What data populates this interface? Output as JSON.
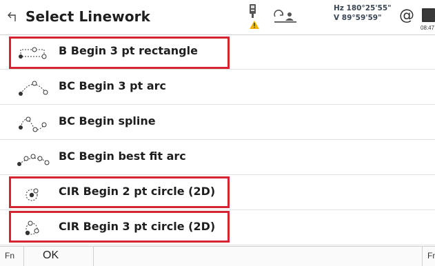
{
  "header": {
    "back_icon": "back-arrow-icon",
    "title": "Select Linework",
    "instrument_icon": "instrument-warning-icon",
    "target_icon": "target-person-icon",
    "hz": "Hz 180°25'55\"",
    "v": "V  89°59'59\"",
    "at_symbol": "@",
    "battery_icon": "battery-icon",
    "time": "08:47"
  },
  "items": [
    {
      "label": "B Begin 3 pt rectangle",
      "icon": "rectangle-3pt-icon",
      "highlighted": true
    },
    {
      "label": "BC Begin 3 pt arc",
      "icon": "arc-3pt-icon",
      "highlighted": false
    },
    {
      "label": "BC Begin spline",
      "icon": "spline-icon",
      "highlighted": false
    },
    {
      "label": "BC Begin best fit arc",
      "icon": "best-fit-arc-icon",
      "highlighted": false
    },
    {
      "label": "CIR Begin 2 pt circle (2D)",
      "icon": "circle-2pt-icon",
      "highlighted": true
    },
    {
      "label": "CIR Begin 3 pt circle (2D)",
      "icon": "circle-3pt-icon",
      "highlighted": true
    }
  ],
  "footer": {
    "fn_left": "Fn",
    "ok": "OK",
    "fn_right": "Fn"
  },
  "colors": {
    "highlight": "#d42430",
    "text": "#1e1e1e"
  }
}
